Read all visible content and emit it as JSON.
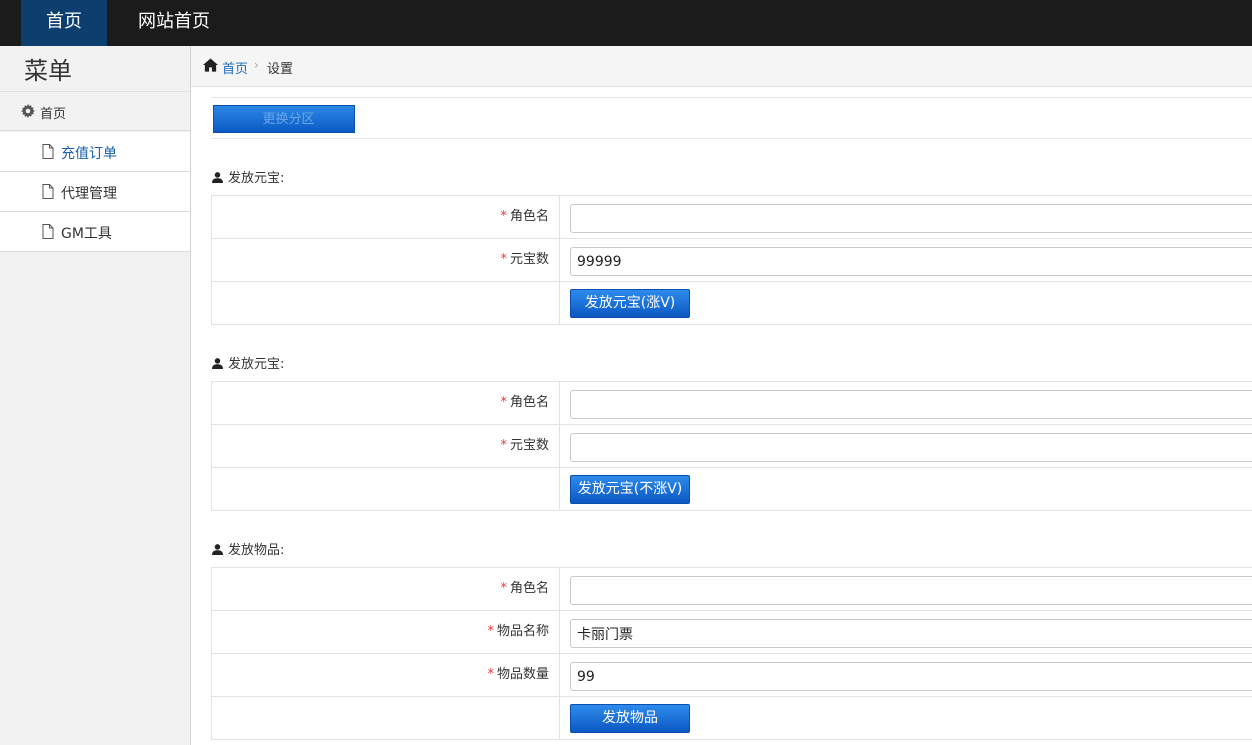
{
  "topnav": {
    "home": "首页",
    "site_home": "网站首页"
  },
  "sidebar": {
    "title": "菜单",
    "home": "首页",
    "items": [
      {
        "label": "充值订单",
        "active": true
      },
      {
        "label": "代理管理",
        "active": false
      },
      {
        "label": "GM工具",
        "active": false
      }
    ]
  },
  "breadcrumb": {
    "home": "首页",
    "current": "设置"
  },
  "partition_button": "更换分区",
  "sections": [
    {
      "title": "发放元宝:",
      "fields": [
        {
          "label": "角色名",
          "value": ""
        },
        {
          "label": "元宝数",
          "value": "99999"
        }
      ],
      "button": "发放元宝(涨V)"
    },
    {
      "title": "发放元宝:",
      "fields": [
        {
          "label": "角色名",
          "value": ""
        },
        {
          "label": "元宝数",
          "value": ""
        }
      ],
      "button": "发放元宝(不涨V)"
    },
    {
      "title": "发放物品:",
      "fields": [
        {
          "label": "角色名",
          "value": ""
        },
        {
          "label": "物品名称",
          "value": "卡丽门票"
        },
        {
          "label": "物品数量",
          "value": "99"
        }
      ],
      "button": "发放物品"
    }
  ],
  "required_mark": "*",
  "colors": {
    "topbar": "#1b1b1b",
    "active_nav": "#0c3e6e",
    "button": "#0b58c2",
    "link": "#1a6bb8",
    "required": "#e4393c"
  }
}
